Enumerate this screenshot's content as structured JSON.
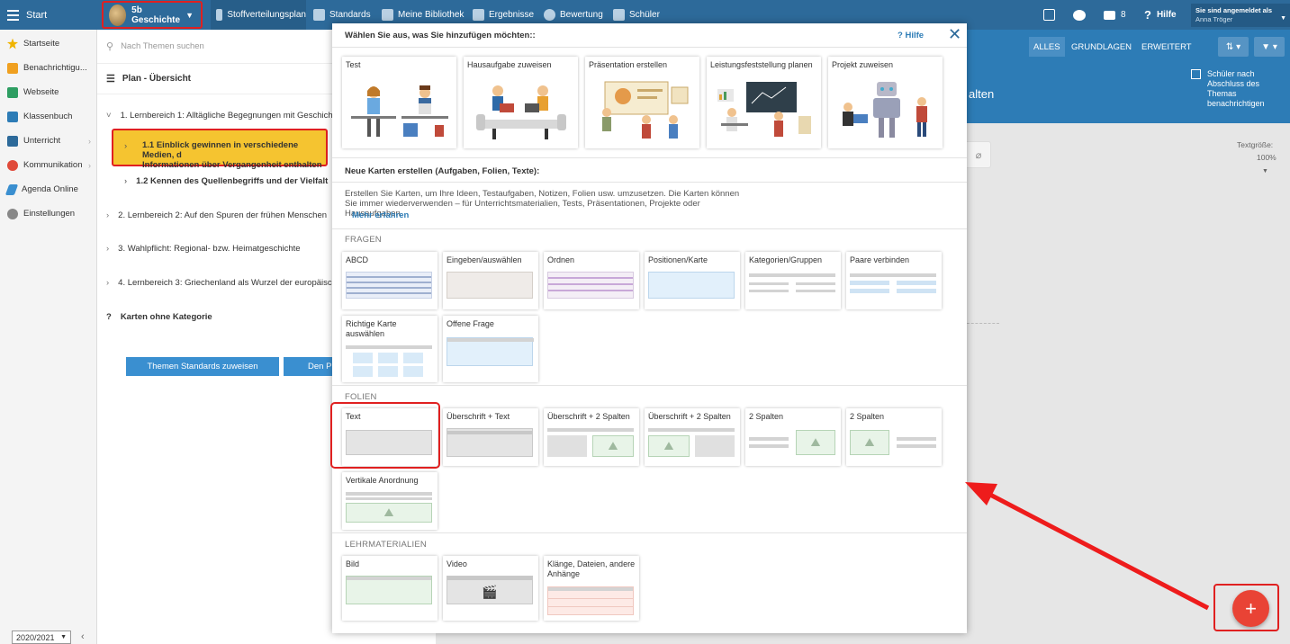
{
  "topbar": {
    "start": "Start",
    "course_line1": "5b",
    "course_line2": "Geschichte",
    "nav": [
      {
        "label": "Stoffverteilungsplan",
        "icon": "calendar-icon"
      },
      {
        "label": "Standards",
        "icon": "shield-icon"
      },
      {
        "label": "Meine Bibliothek",
        "icon": "library-icon"
      },
      {
        "label": "Ergebnisse",
        "icon": "chart-icon"
      },
      {
        "label": "Bewertung",
        "icon": "rating-icon"
      },
      {
        "label": "Schüler",
        "icon": "students-icon"
      }
    ],
    "mail_count": "8",
    "help": "Hilfe",
    "logged_in_label": "Sie sind angemeldet als",
    "user_name": "Anna Tröger"
  },
  "sidebar": {
    "items": [
      {
        "label": "Startseite",
        "icon": "star-icon",
        "color": "#f0b400"
      },
      {
        "label": "Benachrichtigu...",
        "icon": "mail-icon",
        "color": "#f0a020"
      },
      {
        "label": "Webseite",
        "icon": "house-icon",
        "color": "#2e9e62"
      },
      {
        "label": "Klassenbuch",
        "icon": "book-icon",
        "color": "#2d7cb6"
      },
      {
        "label": "Unterricht",
        "icon": "building-icon",
        "color": "#2d6a9a"
      },
      {
        "label": "Kommunikation",
        "icon": "chat-icon",
        "color": "#e04a3a"
      },
      {
        "label": "Agenda Online",
        "icon": "pen-icon",
        "color": "#3a8fd0"
      },
      {
        "label": "Einstellungen",
        "icon": "gear-icon",
        "color": "#888888"
      }
    ],
    "year": "2020/2021"
  },
  "plan": {
    "search_placeholder": "Nach Themen suchen",
    "header": "Plan - Übersicht",
    "items": [
      "1. Lernbereich 1: Alltägliche Begegnungen mit Geschichte",
      "1.2  Kennen des Quellenbegriffs und der Vielfalt",
      "2. Lernbereich 2: Auf den Spuren der frühen Menschen",
      "3. Wahlpflicht: Regional- bzw. Heimatgeschichte",
      "4. Lernbereich 3: Griechenland als Wurzel der europäisch",
      "Karten ohne Kategorie"
    ],
    "highlight_line1": "1.1  Einblick gewinnen in verschiedene Medien, d",
    "highlight_line2": "Informationen über Vergangenheit enthalten",
    "btn1": "Themen Standards zuweisen",
    "btn2": "Den P"
  },
  "right": {
    "filters": [
      "ALLES",
      "GRUNDLAGEN",
      "ERWEITERT"
    ],
    "notify": "Schüler nach Abschluss des Themas benachrichtigen",
    "title_frag": "alten",
    "textsize_label": "Textgröße:",
    "textsize_value": "100%"
  },
  "modal": {
    "title": "Wählen Sie aus, was Sie hinzufügen möchten::",
    "help": "Hilfe",
    "big_cards": [
      "Test",
      "Hausaufgabe zuweisen",
      "Präsentation erstellen",
      "Leistungsfeststellung planen",
      "Projekt zuweisen"
    ],
    "new_cards_title": "Neue Karten erstellen (Aufgaben, Folien, Texte):",
    "description": "Erstellen Sie Karten, um Ihre Ideen, Testaufgaben, Notizen, Folien usw. umzusetzen. Die Karten können Sie immer wiederverwenden – für Unterrichtsmaterialien, Tests, Präsentationen, Projekte oder Hausaufgaben.",
    "more": "Mehr erfahren",
    "categories": {
      "fragen": "FRAGEN",
      "folien": "FOLIEN",
      "lehr": "LEHRMATERIALIEN"
    },
    "fragen": [
      "ABCD",
      "Eingeben/auswählen",
      "Ordnen",
      "Positionen/Karte",
      "Kategorien/Gruppen",
      "Paare verbinden",
      "Richtige Karte auswählen",
      "Offene Frage"
    ],
    "folien": [
      "Text",
      "Überschrift + Text",
      "Überschrift + 2 Spalten",
      "Überschrift + 2 Spalten",
      "2 Spalten",
      "2 Spalten",
      "Vertikale Anordnung"
    ],
    "lehr": [
      "Bild",
      "Video",
      "Klänge, Dateien, andere Anhänge"
    ]
  },
  "fab": "+"
}
